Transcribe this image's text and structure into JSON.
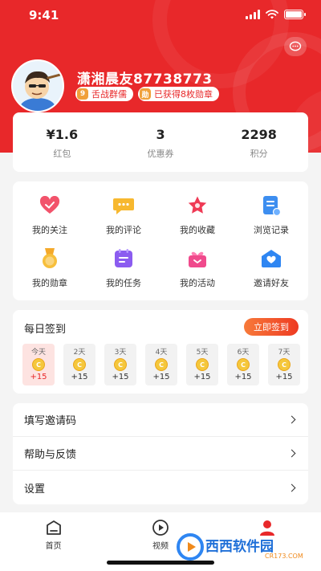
{
  "status_bar": {
    "time": "9:41"
  },
  "profile": {
    "username": "潇湘晨友87738773",
    "badges": [
      {
        "icon": "9",
        "label": "舌战群儒"
      },
      {
        "icon": "勋",
        "label": "已获得8枚勋章"
      }
    ]
  },
  "stats": [
    {
      "value": "¥1.6",
      "label": "红包"
    },
    {
      "value": "3",
      "label": "优惠券"
    },
    {
      "value": "2298",
      "label": "积分"
    }
  ],
  "grid": [
    {
      "label": "我的关注",
      "icon": "heart-icon"
    },
    {
      "label": "我的评论",
      "icon": "chat-bubble-icon"
    },
    {
      "label": "我的收藏",
      "icon": "star-icon"
    },
    {
      "label": "浏览记录",
      "icon": "document-icon"
    },
    {
      "label": "我的勋章",
      "icon": "medal-icon"
    },
    {
      "label": "我的任务",
      "icon": "task-list-icon"
    },
    {
      "label": "我的活动",
      "icon": "gift-icon"
    },
    {
      "label": "邀请好友",
      "icon": "envelope-icon"
    }
  ],
  "signin": {
    "title": "每日签到",
    "button": "立即签到",
    "days": [
      {
        "label": "今天",
        "points": "+15"
      },
      {
        "label": "2天",
        "points": "+15"
      },
      {
        "label": "3天",
        "points": "+15"
      },
      {
        "label": "4天",
        "points": "+15"
      },
      {
        "label": "5天",
        "points": "+15"
      },
      {
        "label": "6天",
        "points": "+15"
      },
      {
        "label": "7天",
        "points": "+15"
      }
    ]
  },
  "menu": [
    {
      "label": "填写邀请码"
    },
    {
      "label": "帮助与反馈"
    },
    {
      "label": "设置"
    }
  ],
  "tabbar": [
    {
      "label": "首页",
      "icon": "home-icon"
    },
    {
      "label": "视频",
      "icon": "play-icon"
    },
    {
      "label": "",
      "icon": "profile-icon"
    }
  ],
  "watermark": {
    "text": "西西软件园",
    "sub": "CR173.COM"
  },
  "colors": {
    "brand": "#e8282a",
    "accent": "#f77a3a",
    "coin": "#f5c73b"
  }
}
